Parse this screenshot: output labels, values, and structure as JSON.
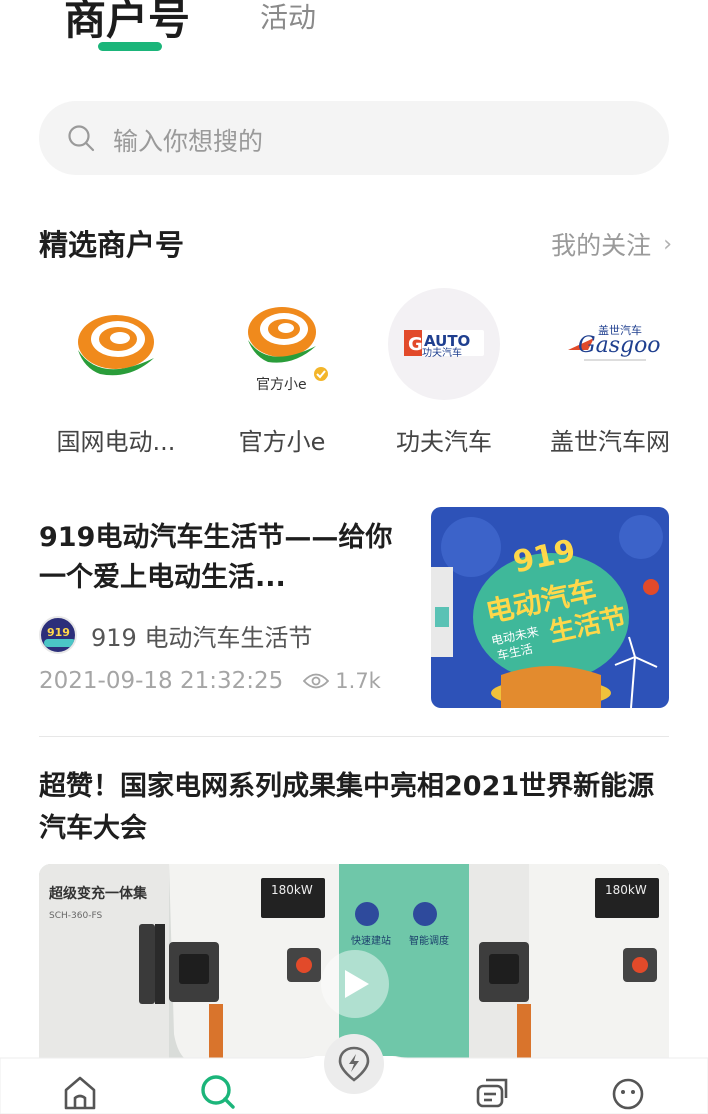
{
  "tabs": {
    "merchants": "商户号",
    "activities": "活动"
  },
  "search": {
    "placeholder": "输入你想搜的"
  },
  "featured": {
    "title": "精选商户号",
    "more": "我的关注",
    "merchants": [
      {
        "name": "国网电动..."
      },
      {
        "name": "官方小e",
        "logo_text": "官方小e"
      },
      {
        "name": "功夫汽车",
        "logo_text": "AUTO 功夫汽车"
      },
      {
        "name": "盖世汽车网",
        "logo_text": "盖世汽车 Gasgoo"
      }
    ]
  },
  "articles": [
    {
      "title": "919电动汽车生活节——给你一个爱上电动生活...",
      "author": "919 电动汽车生活节",
      "date": "2021-09-18 21:32:25",
      "views": "1.7k",
      "thumb_text": {
        "num": "919",
        "line1": "电动汽车",
        "line2": "生活节",
        "sub1": "电动未来",
        "sub2": "车生活"
      }
    },
    {
      "title": "超赞！国家电网系列成果集中亮相2021世界新能源汽车大会",
      "media_text": {
        "left_label": "超级变充一体集",
        "power1": "180kW",
        "power2": "180kW",
        "screen1": "快速建站",
        "screen2": "智能调度"
      }
    }
  ],
  "nav": {
    "items": [
      "home-icon",
      "discover-icon",
      "charge-map-icon",
      "messages-icon",
      "profile-icon"
    ],
    "active_color": "#1bb57a"
  },
  "colors": {
    "accent": "#1bb57a",
    "logo_orange": "#f08a1c",
    "logo_green": "#2a9d3a"
  }
}
